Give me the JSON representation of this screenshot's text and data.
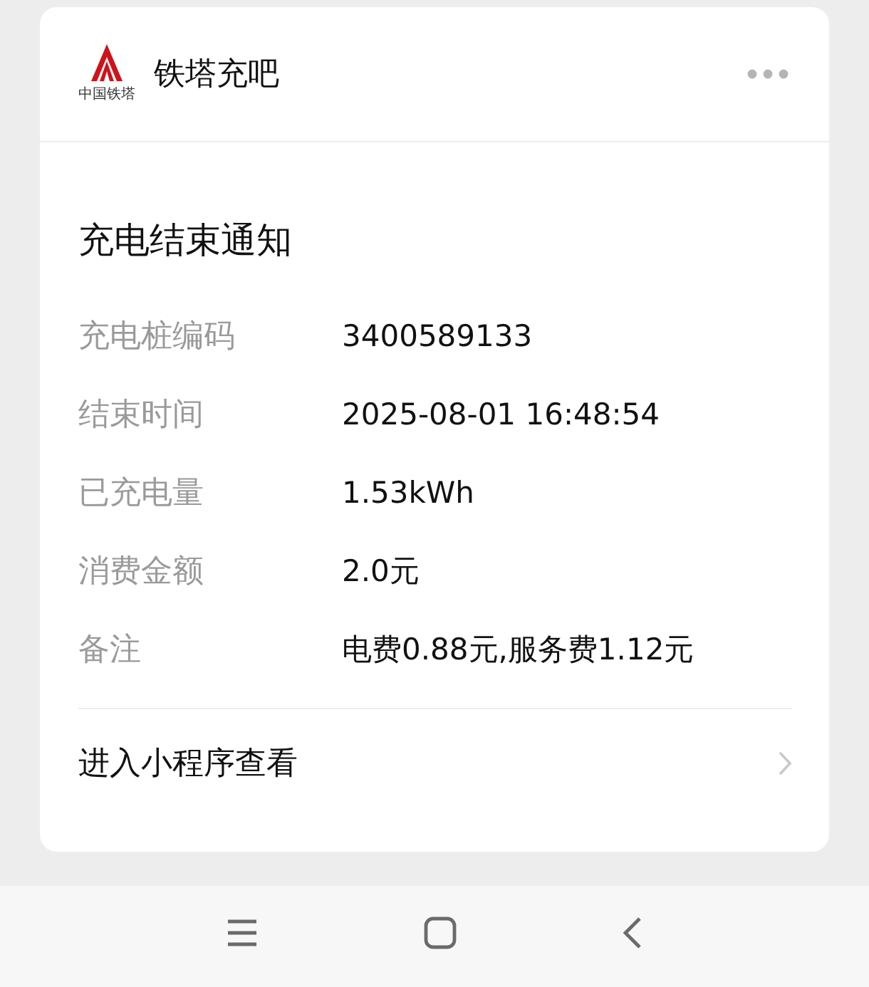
{
  "header": {
    "logo_text": "中国铁塔",
    "name": "铁塔充吧"
  },
  "notice": {
    "title": "充电结束通知",
    "fields": [
      {
        "label": "充电桩编码",
        "value": "3400589133"
      },
      {
        "label": "结束时间",
        "value": "2025-08-01 16:48:54"
      },
      {
        "label": "已充电量",
        "value": "1.53kWh"
      },
      {
        "label": "消费金额",
        "value": "2.0元"
      },
      {
        "label": "备注",
        "value": "电费0.88元,服务费1.12元"
      }
    ],
    "link": "进入小程序查看"
  }
}
